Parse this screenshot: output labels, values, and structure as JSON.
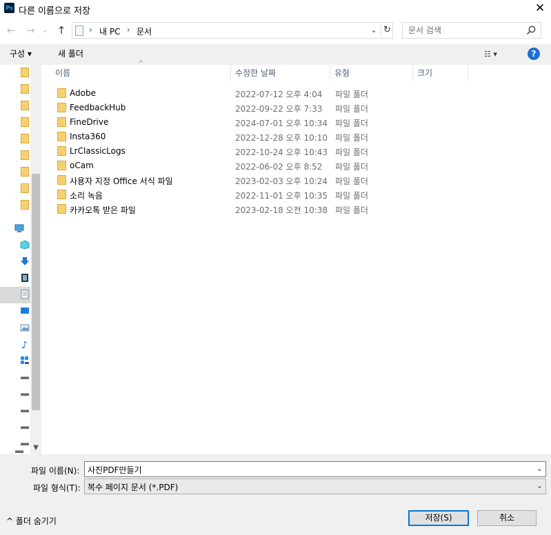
{
  "window": {
    "app_icon": "Ps",
    "title": "다른 이름으로 저장",
    "close_glyph": "✕"
  },
  "nav": {
    "back_glyph": "←",
    "forward_glyph": "→",
    "recent_glyph": "⌄",
    "up_glyph": "↑",
    "breadcrumb": [
      "내 PC",
      "문서"
    ],
    "breadcrumb_sep": "›",
    "dropdown_glyph": "⌄",
    "refresh_glyph": "↻",
    "search_placeholder": "문서 검색"
  },
  "toolbar": {
    "organize_label": "구성 ▾",
    "new_folder_label": "새 폴더",
    "view_glyph": "☷ ▾",
    "help_glyph": "?"
  },
  "navpane": {
    "icons": [
      "folder-icon",
      "folder-icon",
      "folder-icon",
      "folder-icon",
      "folder-icon",
      "folder-icon",
      "folder-icon",
      "folder-icon",
      "folder-icon",
      "pc-icon",
      "3d-objects-icon",
      "downloads-icon",
      "videos-icon",
      "documents-icon",
      "desktop-icon",
      "pictures-icon",
      "music-icon",
      "windows-drive-icon",
      "drive-icon",
      "drive-icon",
      "drive-icon",
      "drive-icon",
      "drive-icon",
      "network-drive-icon"
    ],
    "selected_index": 13
  },
  "columns": {
    "name": "이름",
    "date": "수정한 날짜",
    "type": "유형",
    "size": "크기",
    "sort_glyph": "^"
  },
  "files": [
    {
      "name": "Adobe",
      "date": "2022-07-12 오후 4:04",
      "type": "파일 폴더"
    },
    {
      "name": "FeedbackHub",
      "date": "2022-09-22 오후 7:33",
      "type": "파일 폴더"
    },
    {
      "name": "FineDrive",
      "date": "2024-07-01 오후 10:34",
      "type": "파일 폴더"
    },
    {
      "name": "Insta360",
      "date": "2022-12-28 오후 10:10",
      "type": "파일 폴더"
    },
    {
      "name": "LrClassicLogs",
      "date": "2022-10-24 오후 10:43",
      "type": "파일 폴더"
    },
    {
      "name": "oCam",
      "date": "2022-06-02 오후 8:52",
      "type": "파일 폴더"
    },
    {
      "name": "사용자 지정 Office 서식 파일",
      "date": "2023-02-03 오후 10:24",
      "type": "파일 폴더"
    },
    {
      "name": "소리 녹음",
      "date": "2022-11-01 오후 10:35",
      "type": "파일 폴더"
    },
    {
      "name": "카카오톡 받은 파일",
      "date": "2023-02-18 오전 10:38",
      "type": "파일 폴더"
    }
  ],
  "form": {
    "filename_label": "파일 이름(N):",
    "filename_value": "사진PDF만들기",
    "filetype_label": "파일 형식(T):",
    "filetype_value": "복수 페이지 문서 (*.PDF)",
    "arrow_glyph": "⌄"
  },
  "footer": {
    "hide_folders_label": "^  폴더 숨기기",
    "save_label": "저장(S)",
    "cancel_label": "취소"
  },
  "colors": {
    "accent": "#0078d7",
    "folder": "#f7d070",
    "help": "#1e6fd1"
  }
}
